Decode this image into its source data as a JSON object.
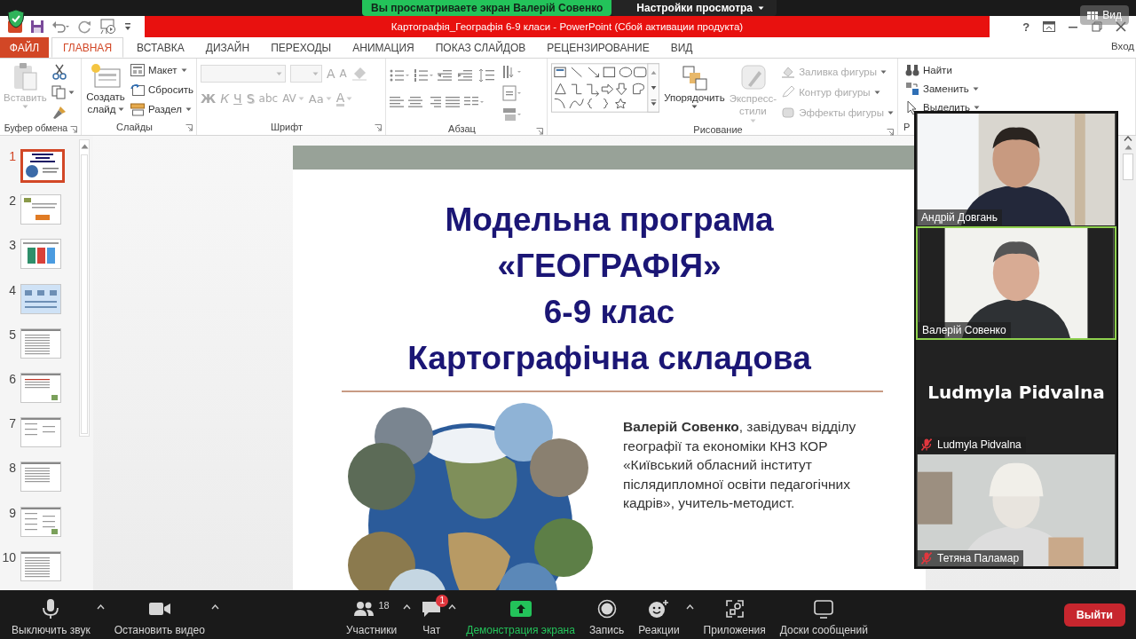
{
  "zoom_top": {
    "share_banner": "Вы просматриваете экран Валерій Совенко",
    "view_options": "Настройки просмотра",
    "view_button": "Вид"
  },
  "title_bar": {
    "title": "Картографія_Географія 6-9 класи -  PowerPoint (Сбой активации продукта)",
    "help": "?"
  },
  "ribbon_tabs": [
    {
      "label": "ФАЙЛ",
      "kind": "file",
      "selected": false
    },
    {
      "label": "ГЛАВНАЯ",
      "kind": "tab",
      "selected": true
    },
    {
      "label": "ВСТАВКА",
      "kind": "tab",
      "selected": false
    },
    {
      "label": "ДИЗАЙН",
      "kind": "tab",
      "selected": false
    },
    {
      "label": "ПЕРЕХОДЫ",
      "kind": "tab",
      "selected": false
    },
    {
      "label": "АНИМАЦИЯ",
      "kind": "tab",
      "selected": false
    },
    {
      "label": "ПОКАЗ СЛАЙДОВ",
      "kind": "tab",
      "selected": false
    },
    {
      "label": "РЕЦЕНЗИРОВАНИЕ",
      "kind": "tab",
      "selected": false
    },
    {
      "label": "ВИД",
      "kind": "tab",
      "selected": false
    }
  ],
  "sign_in": "Вход",
  "ribbon_groups": [
    {
      "kind": "clipboard",
      "label": "Буфер обмена",
      "paste": {
        "label": "Вставить",
        "disabled": true
      }
    },
    {
      "kind": "slides",
      "label": "Слайды",
      "new_slide": "Создать слайд",
      "commands": [
        {
          "label": "Макет",
          "dropdown": true
        },
        {
          "label": "Сбросить",
          "dropdown": false
        },
        {
          "label": "Раздел",
          "dropdown": true
        }
      ]
    },
    {
      "kind": "font",
      "label": "Шрифт",
      "disabled": true,
      "size_buttons": [
        "A",
        "A"
      ],
      "format_buttons": [
        {
          "label": "Ж",
          "kind": "bold"
        },
        {
          "label": "К",
          "kind": "italic"
        },
        {
          "label": "Ч",
          "kind": "underline"
        },
        {
          "label": "S",
          "kind": "shadow"
        },
        {
          "label": "abc",
          "kind": "strike"
        },
        {
          "label": "AV",
          "kind": "spacing"
        },
        {
          "label": "Aa",
          "kind": "case"
        },
        {
          "label": "A",
          "kind": "color"
        }
      ]
    },
    {
      "kind": "paragraph",
      "label": "Абзац"
    },
    {
      "kind": "drawing",
      "label": "Рисование",
      "arrange": "Упорядочить",
      "quick_styles": {
        "label": "Экспресс-стили",
        "disabled": true
      },
      "shape_commands": [
        {
          "label": "Заливка фигуры",
          "disabled": true
        },
        {
          "label": "Контур фигуры",
          "disabled": true
        },
        {
          "label": "Эффекты фигуры",
          "disabled": true
        }
      ]
    },
    {
      "kind": "editing",
      "label": "Р",
      "commands": [
        {
          "label": "Найти",
          "dropdown": false
        },
        {
          "label": "Заменить",
          "dropdown": true
        },
        {
          "label": "Выделить",
          "dropdown": true
        }
      ]
    }
  ],
  "slides": [
    {
      "number": "1",
      "selected": true
    },
    {
      "number": "2",
      "selected": false
    },
    {
      "number": "3",
      "selected": false
    },
    {
      "number": "4",
      "selected": false
    },
    {
      "number": "5",
      "selected": false
    },
    {
      "number": "6",
      "selected": false
    },
    {
      "number": "7",
      "selected": false
    },
    {
      "number": "8",
      "selected": false
    },
    {
      "number": "9",
      "selected": false
    },
    {
      "number": "10",
      "selected": false
    }
  ],
  "current_slide": {
    "title_lines": [
      "Модельна програма",
      "«ГЕОГРАФІЯ»",
      "6-9 клас",
      "Картографічна складова"
    ],
    "author_note": "**Валерій Совенко**, завідувач відділу географії та економіки КНЗ КОР «Київський обласний інститут післядипломної освіти педагогічних кадрів», учитель-методист."
  },
  "video_tiles": [
    {
      "name": "Андрій Довгань",
      "kind": "video",
      "muted": false,
      "speaking": false
    },
    {
      "name": "Валерій Совенко",
      "kind": "video",
      "muted": false,
      "speaking": true
    },
    {
      "name": "Ludmyla Pidvalna",
      "kind": "name_only",
      "display_name": "Ludmyla Pidvalna",
      "muted": true,
      "speaking": false
    },
    {
      "name": "Тетяна Паламар",
      "kind": "video",
      "muted": true,
      "speaking": false
    }
  ],
  "toolbar": [
    {
      "kind": "mute",
      "label": "Выключить звук",
      "menu": true
    },
    {
      "kind": "video",
      "label": "Остановить видео",
      "menu": true
    },
    {
      "kind": "participants",
      "label": "Участники",
      "count": "18",
      "menu": true
    },
    {
      "kind": "chat",
      "label": "Чат",
      "badge": "1",
      "menu": true
    },
    {
      "kind": "share",
      "label": "Демонстрация экрана",
      "menu": false
    },
    {
      "kind": "record",
      "label": "Запись",
      "menu": false
    },
    {
      "kind": "reactions",
      "label": "Реакции",
      "menu": true
    },
    {
      "kind": "apps",
      "label": "Приложения",
      "menu": false
    },
    {
      "kind": "whiteboards",
      "label": "Доски сообщений",
      "menu": false
    },
    {
      "kind": "leave",
      "label": "Выйти"
    }
  ]
}
